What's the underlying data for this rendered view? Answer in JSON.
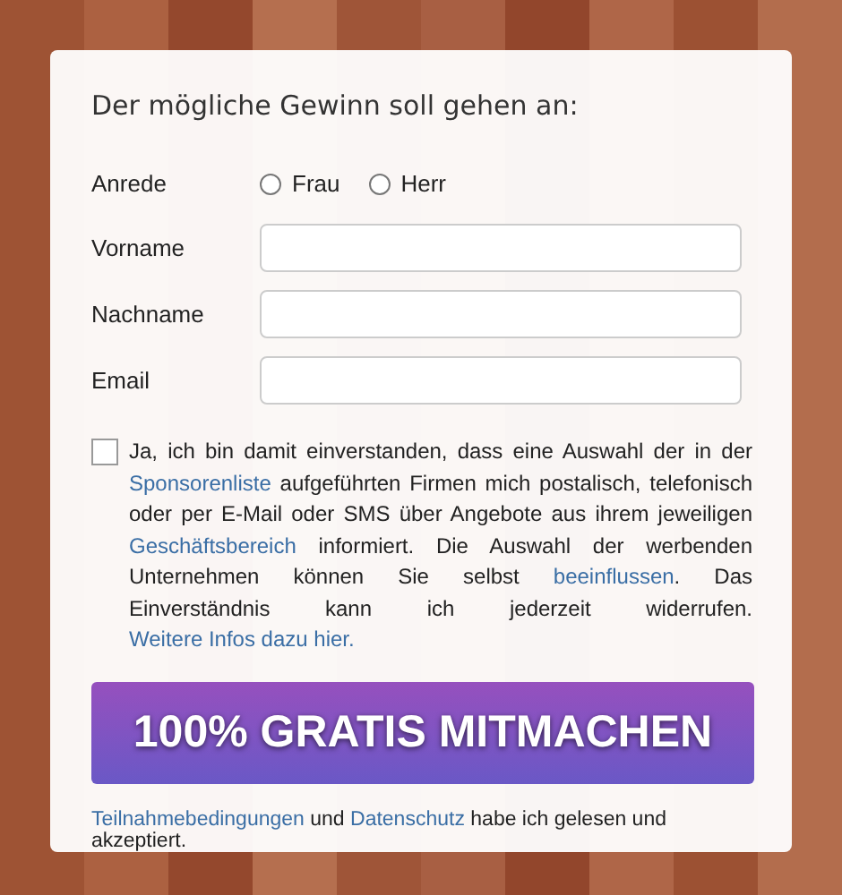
{
  "heading": "Der mögliche Gewinn soll gehen an:",
  "salutation": {
    "label": "Anrede",
    "options": [
      {
        "label": "Frau",
        "selected": false
      },
      {
        "label": "Herr",
        "selected": false
      }
    ]
  },
  "fields": [
    {
      "label": "Vorname"
    },
    {
      "label": "Nachname"
    },
    {
      "label": "Email"
    }
  ],
  "consent": {
    "checked": false,
    "parts": [
      {
        "kind": "text",
        "text": "Ja, ich bin damit einverstanden, dass eine Auswahl der in der "
      },
      {
        "kind": "link",
        "text": "Sponsorenliste"
      },
      {
        "kind": "text",
        "text": " aufgeführten Firmen mich postalisch, telefonisch oder per E-Mail oder SMS über Angebote aus ihrem jeweiligen "
      },
      {
        "kind": "link",
        "text": "Geschäftsbereich"
      },
      {
        "kind": "text",
        "text": " informiert. Die Auswahl der werbenden Unternehmen können Sie selbst "
      },
      {
        "kind": "link",
        "text": "beeinflussen"
      },
      {
        "kind": "text",
        "text": ". Das Einverständnis kann ich jederzeit widerrufen. "
      },
      {
        "kind": "link",
        "text": "Weitere Infos dazu hier."
      }
    ]
  },
  "submit": "100% GRATIS MITMACHEN",
  "footer": [
    {
      "kind": "link",
      "text": "Teilnahmebedingungen"
    },
    {
      "kind": "text",
      "text": " und "
    },
    {
      "kind": "link",
      "text": "Datenschutz"
    },
    {
      "kind": "text",
      "text": " habe ich gelesen und akzeptiert."
    }
  ]
}
